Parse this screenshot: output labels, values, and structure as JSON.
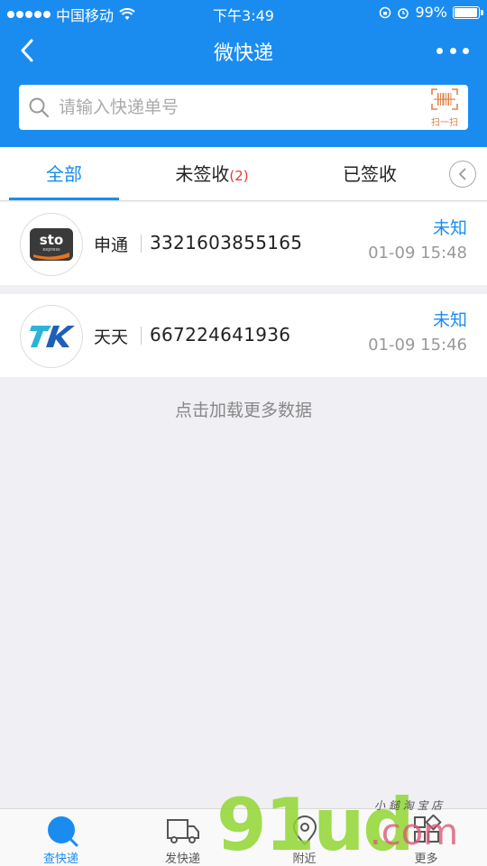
{
  "status_bar": {
    "carrier": "中国移动",
    "time": "下午3:49",
    "battery": "99%",
    "battery_level": 0.99
  },
  "navbar": {
    "title": "微快递"
  },
  "search": {
    "placeholder": "请输入快递单号",
    "scan_label": "扫一扫"
  },
  "tabs": [
    {
      "label": "全部",
      "active": true
    },
    {
      "label": "未签收",
      "badge": "(2)",
      "active": false
    },
    {
      "label": "已签收",
      "active": false
    }
  ],
  "shipments": [
    {
      "carrier": "申通",
      "tracking_no": "3321603855165",
      "status": "未知",
      "time": "01-09 15:48",
      "logo": "sto-express-logo"
    },
    {
      "carrier": "天天",
      "tracking_no": "667224641936",
      "status": "未知",
      "time": "01-09 15:46",
      "logo": "tiantian-express-logo"
    }
  ],
  "load_more": "点击加载更多数据",
  "bottom_tabs": [
    {
      "label": "查快递",
      "icon": "search-circle-icon",
      "active": true
    },
    {
      "label": "发快递",
      "icon": "truck-icon",
      "active": false
    },
    {
      "label": "附近",
      "icon": "location-icon",
      "active": false
    },
    {
      "label": "更多",
      "icon": "grid-icon",
      "active": false
    }
  ],
  "watermark": {
    "big": "91ud",
    "com": ".com",
    "small": "小 鎚 淘 宝 店"
  },
  "colors": {
    "primary": "#1a8cf0",
    "badge": "#e53935",
    "background": "#efeff4"
  }
}
